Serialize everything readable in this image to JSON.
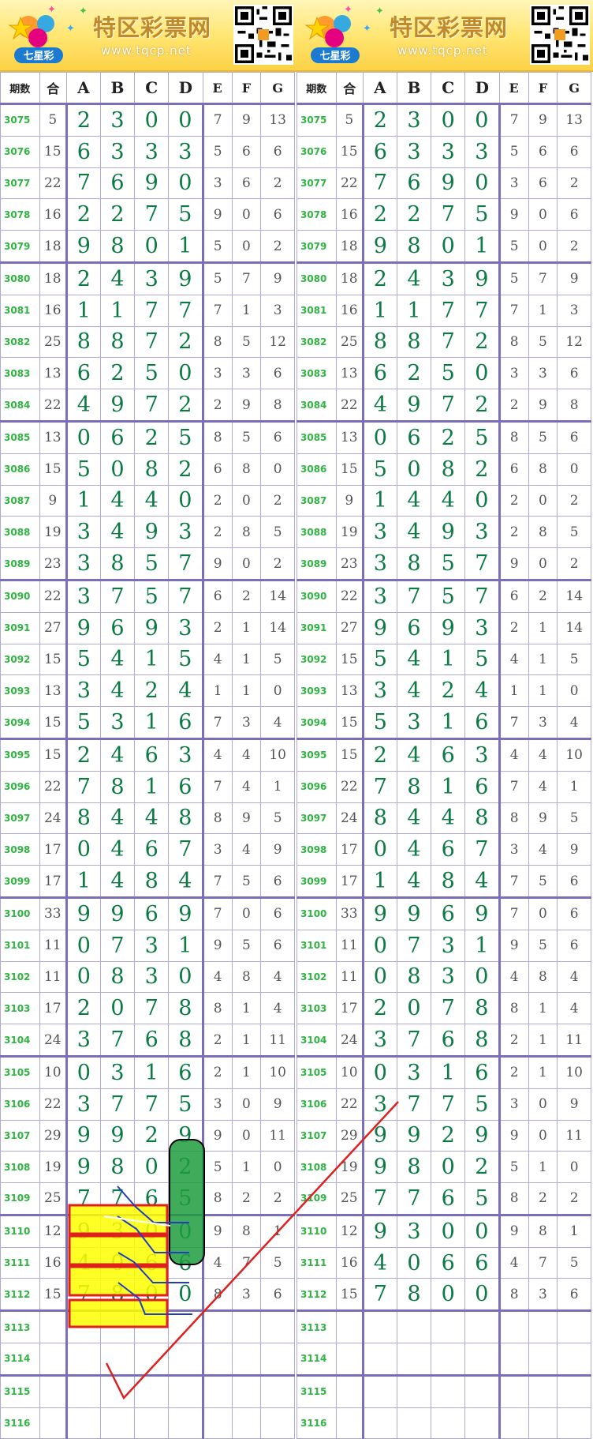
{
  "site": {
    "title": "特区彩票网",
    "url": "www.tqcp.net",
    "logo_text": "七星彩"
  },
  "columns": [
    "期数",
    "合",
    "A",
    "B",
    "C",
    "D",
    "E",
    "F",
    "G"
  ],
  "rows": [
    {
      "issue": "3075",
      "sum": "5",
      "a": "2",
      "b": "3",
      "c": "0",
      "d": "0",
      "e": "7",
      "f": "9",
      "g": "13"
    },
    {
      "issue": "3076",
      "sum": "15",
      "a": "6",
      "b": "3",
      "c": "3",
      "d": "3",
      "e": "5",
      "f": "6",
      "g": "6"
    },
    {
      "issue": "3077",
      "sum": "22",
      "a": "7",
      "b": "6",
      "c": "9",
      "d": "0",
      "e": "3",
      "f": "6",
      "g": "2"
    },
    {
      "issue": "3078",
      "sum": "16",
      "a": "2",
      "b": "2",
      "c": "7",
      "d": "5",
      "e": "9",
      "f": "0",
      "g": "6"
    },
    {
      "issue": "3079",
      "sum": "18",
      "a": "9",
      "b": "8",
      "c": "0",
      "d": "1",
      "e": "5",
      "f": "0",
      "g": "2"
    },
    {
      "issue": "3080",
      "sum": "18",
      "a": "2",
      "b": "4",
      "c": "3",
      "d": "9",
      "e": "5",
      "f": "7",
      "g": "9"
    },
    {
      "issue": "3081",
      "sum": "16",
      "a": "1",
      "b": "1",
      "c": "7",
      "d": "7",
      "e": "7",
      "f": "1",
      "g": "3"
    },
    {
      "issue": "3082",
      "sum": "25",
      "a": "8",
      "b": "8",
      "c": "7",
      "d": "2",
      "e": "8",
      "f": "5",
      "g": "12"
    },
    {
      "issue": "3083",
      "sum": "13",
      "a": "6",
      "b": "2",
      "c": "5",
      "d": "0",
      "e": "3",
      "f": "3",
      "g": "6"
    },
    {
      "issue": "3084",
      "sum": "22",
      "a": "4",
      "b": "9",
      "c": "7",
      "d": "2",
      "e": "2",
      "f": "9",
      "g": "8"
    },
    {
      "issue": "3085",
      "sum": "13",
      "a": "0",
      "b": "6",
      "c": "2",
      "d": "5",
      "e": "8",
      "f": "5",
      "g": "6"
    },
    {
      "issue": "3086",
      "sum": "15",
      "a": "5",
      "b": "0",
      "c": "8",
      "d": "2",
      "e": "6",
      "f": "8",
      "g": "0"
    },
    {
      "issue": "3087",
      "sum": "9",
      "a": "1",
      "b": "4",
      "c": "4",
      "d": "0",
      "e": "2",
      "f": "0",
      "g": "2"
    },
    {
      "issue": "3088",
      "sum": "19",
      "a": "3",
      "b": "4",
      "c": "9",
      "d": "3",
      "e": "2",
      "f": "8",
      "g": "5"
    },
    {
      "issue": "3089",
      "sum": "23",
      "a": "3",
      "b": "8",
      "c": "5",
      "d": "7",
      "e": "9",
      "f": "0",
      "g": "2"
    },
    {
      "issue": "3090",
      "sum": "22",
      "a": "3",
      "b": "7",
      "c": "5",
      "d": "7",
      "e": "6",
      "f": "2",
      "g": "14"
    },
    {
      "issue": "3091",
      "sum": "27",
      "a": "9",
      "b": "6",
      "c": "9",
      "d": "3",
      "e": "2",
      "f": "1",
      "g": "14"
    },
    {
      "issue": "3092",
      "sum": "15",
      "a": "5",
      "b": "4",
      "c": "1",
      "d": "5",
      "e": "4",
      "f": "1",
      "g": "5"
    },
    {
      "issue": "3093",
      "sum": "13",
      "a": "3",
      "b": "4",
      "c": "2",
      "d": "4",
      "e": "1",
      "f": "1",
      "g": "0"
    },
    {
      "issue": "3094",
      "sum": "15",
      "a": "5",
      "b": "3",
      "c": "1",
      "d": "6",
      "e": "7",
      "f": "3",
      "g": "4"
    },
    {
      "issue": "3095",
      "sum": "15",
      "a": "2",
      "b": "4",
      "c": "6",
      "d": "3",
      "e": "4",
      "f": "4",
      "g": "10"
    },
    {
      "issue": "3096",
      "sum": "22",
      "a": "7",
      "b": "8",
      "c": "1",
      "d": "6",
      "e": "7",
      "f": "4",
      "g": "1"
    },
    {
      "issue": "3097",
      "sum": "24",
      "a": "8",
      "b": "4",
      "c": "4",
      "d": "8",
      "e": "8",
      "f": "9",
      "g": "5"
    },
    {
      "issue": "3098",
      "sum": "17",
      "a": "0",
      "b": "4",
      "c": "6",
      "d": "7",
      "e": "3",
      "f": "4",
      "g": "9"
    },
    {
      "issue": "3099",
      "sum": "17",
      "a": "1",
      "b": "4",
      "c": "8",
      "d": "4",
      "e": "7",
      "f": "5",
      "g": "6"
    },
    {
      "issue": "3100",
      "sum": "33",
      "a": "9",
      "b": "9",
      "c": "6",
      "d": "9",
      "e": "7",
      "f": "0",
      "g": "6"
    },
    {
      "issue": "3101",
      "sum": "11",
      "a": "0",
      "b": "7",
      "c": "3",
      "d": "1",
      "e": "9",
      "f": "5",
      "g": "6"
    },
    {
      "issue": "3102",
      "sum": "11",
      "a": "0",
      "b": "8",
      "c": "3",
      "d": "0",
      "e": "4",
      "f": "8",
      "g": "4"
    },
    {
      "issue": "3103",
      "sum": "17",
      "a": "2",
      "b": "0",
      "c": "7",
      "d": "8",
      "e": "8",
      "f": "1",
      "g": "4"
    },
    {
      "issue": "3104",
      "sum": "24",
      "a": "3",
      "b": "7",
      "c": "6",
      "d": "8",
      "e": "2",
      "f": "1",
      "g": "11"
    },
    {
      "issue": "3105",
      "sum": "10",
      "a": "0",
      "b": "3",
      "c": "1",
      "d": "6",
      "e": "2",
      "f": "1",
      "g": "10"
    },
    {
      "issue": "3106",
      "sum": "22",
      "a": "3",
      "b": "7",
      "c": "7",
      "d": "5",
      "e": "3",
      "f": "0",
      "g": "9"
    },
    {
      "issue": "3107",
      "sum": "29",
      "a": "9",
      "b": "9",
      "c": "2",
      "d": "9",
      "e": "9",
      "f": "0",
      "g": "11"
    },
    {
      "issue": "3108",
      "sum": "19",
      "a": "9",
      "b": "8",
      "c": "0",
      "d": "2",
      "e": "5",
      "f": "1",
      "g": "0"
    },
    {
      "issue": "3109",
      "sum": "25",
      "a": "7",
      "b": "7",
      "c": "6",
      "d": "5",
      "e": "8",
      "f": "2",
      "g": "2"
    },
    {
      "issue": "3110",
      "sum": "12",
      "a": "9",
      "b": "3",
      "c": "0",
      "d": "0",
      "e": "9",
      "f": "8",
      "g": "1"
    },
    {
      "issue": "3111",
      "sum": "16",
      "a": "4",
      "b": "0",
      "c": "6",
      "d": "6",
      "e": "4",
      "f": "7",
      "g": "5"
    },
    {
      "issue": "3112",
      "sum": "15",
      "a": "7",
      "b": "8",
      "c": "0",
      "d": "0",
      "e": "8",
      "f": "3",
      "g": "6"
    },
    {
      "issue": "3113",
      "sum": "",
      "a": "",
      "b": "",
      "c": "",
      "d": "",
      "e": "",
      "f": "",
      "g": ""
    },
    {
      "issue": "3114",
      "sum": "",
      "a": "",
      "b": "",
      "c": "",
      "d": "",
      "e": "",
      "f": "",
      "g": ""
    },
    {
      "issue": "3115",
      "sum": "",
      "a": "",
      "b": "",
      "c": "",
      "d": "",
      "e": "",
      "f": "",
      "g": ""
    },
    {
      "issue": "3116",
      "sum": "",
      "a": "",
      "b": "",
      "c": "",
      "d": "",
      "e": "",
      "f": "",
      "g": ""
    }
  ],
  "colors": {
    "issue": "#2fb542",
    "big_digit": "#0b7a43",
    "small_digit": "#555555",
    "grid_line": "#7a6fb8",
    "highlight_fill": "#ffff00",
    "highlight_border": "#e0201e",
    "capsule_fill": "#1f9e3e",
    "annotation_line": "#1f3fbf",
    "check_mark": "#e0201e"
  }
}
